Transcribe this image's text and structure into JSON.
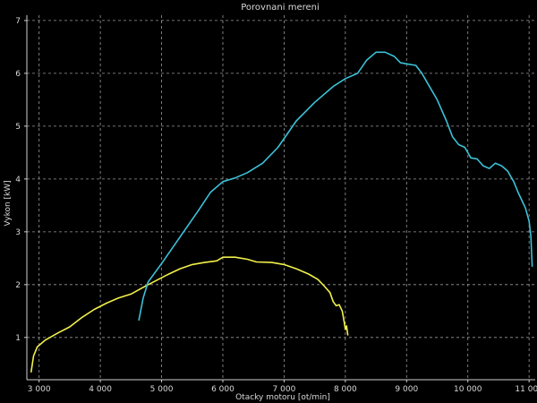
{
  "chart_data": {
    "type": "line",
    "title": "Porovnani mereni",
    "xlabel": "Otacky motoru [ot/min]",
    "ylabel": "Vykon [kW]",
    "xlim": [
      2800,
      11100
    ],
    "ylim": [
      0.2,
      7.1
    ],
    "x_ticks": [
      {
        "value": 3000,
        "label": "3 000"
      },
      {
        "value": 4000,
        "label": "4 000"
      },
      {
        "value": 5000,
        "label": "5 000"
      },
      {
        "value": 6000,
        "label": "6 000"
      },
      {
        "value": 7000,
        "label": "7 000"
      },
      {
        "value": 8000,
        "label": "8 000"
      },
      {
        "value": 9000,
        "label": "9 000"
      },
      {
        "value": 10000,
        "label": "10 000"
      },
      {
        "value": 11000,
        "label": "11 000"
      }
    ],
    "y_ticks": [
      {
        "value": 1,
        "label": "1"
      },
      {
        "value": 2,
        "label": "2"
      },
      {
        "value": 3,
        "label": "3"
      },
      {
        "value": 4,
        "label": "4"
      },
      {
        "value": 5,
        "label": "5"
      },
      {
        "value": 6,
        "label": "6"
      },
      {
        "value": 7,
        "label": "7"
      }
    ],
    "grid": true,
    "series": [
      {
        "color": "#f2f04a",
        "points": [
          [
            2870,
            0.35
          ],
          [
            2910,
            0.65
          ],
          [
            2970,
            0.82
          ],
          [
            3100,
            0.95
          ],
          [
            3300,
            1.08
          ],
          [
            3500,
            1.2
          ],
          [
            3700,
            1.38
          ],
          [
            3900,
            1.53
          ],
          [
            4100,
            1.65
          ],
          [
            4300,
            1.75
          ],
          [
            4500,
            1.82
          ],
          [
            4700,
            1.95
          ],
          [
            4900,
            2.07
          ],
          [
            5100,
            2.19
          ],
          [
            5300,
            2.3
          ],
          [
            5500,
            2.38
          ],
          [
            5700,
            2.42
          ],
          [
            5900,
            2.45
          ],
          [
            6000,
            2.52
          ],
          [
            6200,
            2.52
          ],
          [
            6400,
            2.48
          ],
          [
            6550,
            2.43
          ],
          [
            6800,
            2.42
          ],
          [
            7000,
            2.38
          ],
          [
            7200,
            2.3
          ],
          [
            7400,
            2.2
          ],
          [
            7550,
            2.1
          ],
          [
            7650,
            1.98
          ],
          [
            7750,
            1.85
          ],
          [
            7800,
            1.68
          ],
          [
            7850,
            1.6
          ],
          [
            7900,
            1.62
          ],
          [
            7950,
            1.5
          ],
          [
            7980,
            1.3
          ],
          [
            8000,
            1.15
          ],
          [
            8020,
            1.22
          ],
          [
            8040,
            1.05
          ]
        ]
      },
      {
        "color": "#3cc1d8",
        "points": [
          [
            4630,
            1.33
          ],
          [
            4700,
            1.75
          ],
          [
            4780,
            2.05
          ],
          [
            5000,
            2.4
          ],
          [
            5300,
            2.9
          ],
          [
            5600,
            3.4
          ],
          [
            5800,
            3.75
          ],
          [
            6000,
            3.95
          ],
          [
            6200,
            4.02
          ],
          [
            6400,
            4.12
          ],
          [
            6650,
            4.3
          ],
          [
            6900,
            4.6
          ],
          [
            7200,
            5.1
          ],
          [
            7500,
            5.45
          ],
          [
            7800,
            5.75
          ],
          [
            8000,
            5.9
          ],
          [
            8200,
            6.0
          ],
          [
            8350,
            6.25
          ],
          [
            8500,
            6.4
          ],
          [
            8650,
            6.4
          ],
          [
            8800,
            6.32
          ],
          [
            8900,
            6.2
          ],
          [
            9000,
            6.18
          ],
          [
            9150,
            6.15
          ],
          [
            9250,
            6.0
          ],
          [
            9350,
            5.8
          ],
          [
            9500,
            5.5
          ],
          [
            9650,
            5.1
          ],
          [
            9750,
            4.8
          ],
          [
            9850,
            4.65
          ],
          [
            9950,
            4.6
          ],
          [
            10050,
            4.4
          ],
          [
            10150,
            4.38
          ],
          [
            10250,
            4.25
          ],
          [
            10350,
            4.2
          ],
          [
            10450,
            4.3
          ],
          [
            10550,
            4.25
          ],
          [
            10650,
            4.15
          ],
          [
            10750,
            3.95
          ],
          [
            10820,
            3.75
          ],
          [
            10880,
            3.6
          ],
          [
            10940,
            3.45
          ],
          [
            11000,
            3.2
          ],
          [
            11030,
            2.9
          ],
          [
            11050,
            2.35
          ]
        ]
      }
    ]
  }
}
